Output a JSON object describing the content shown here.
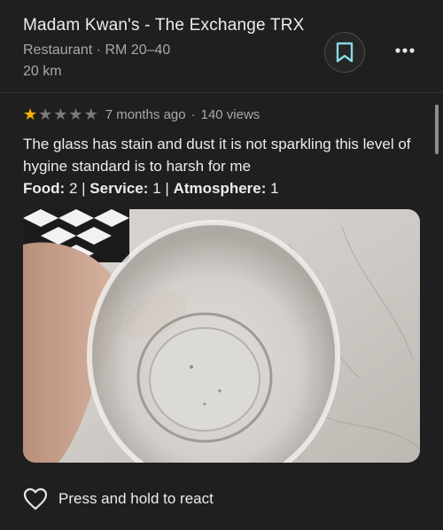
{
  "place": {
    "name": "Madam Kwan's - The Exchange TRX",
    "category": "Restaurant",
    "separator": "·",
    "price": "RM 20–40",
    "distance": "20 km"
  },
  "actions": {
    "save_icon": "bookmark-icon",
    "more_icon": "more-vert-icon",
    "accent_color": "#8ad6e6"
  },
  "review": {
    "rating": 1,
    "max_rating": 5,
    "time_ago": "7 months ago",
    "dot": "·",
    "views": "140 views",
    "text": "The glass has stain and dust it is not sparkling this level of hygine standard is to harsh for me",
    "subratings": [
      {
        "label": "Food:",
        "value": "2"
      },
      {
        "label": "Service:",
        "value": "1"
      },
      {
        "label": "Atmosphere:",
        "value": "1"
      }
    ],
    "subrating_separator": "|",
    "photo": "photo of an empty drinking glass held over a marble table"
  },
  "footer": {
    "react_icon": "heart-outline-icon",
    "react_label": "Press and hold to react"
  },
  "star_colors": {
    "filled": "#f6b400",
    "empty": "#7a7a7a"
  }
}
